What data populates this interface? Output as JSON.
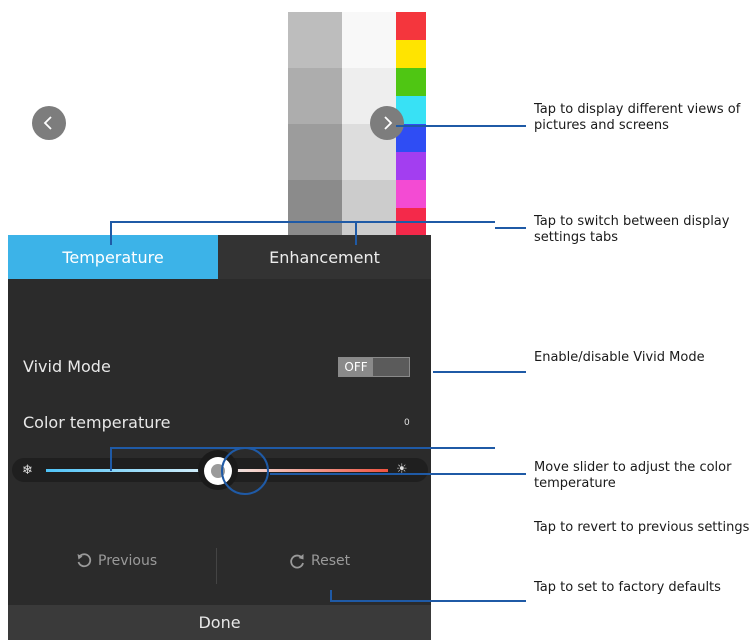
{
  "preview": {
    "nav_prev_icon": "chevron-left-icon",
    "nav_next_icon": "chevron-right-icon",
    "gray_column_1": [
      "#bdbdbd",
      "#adadad",
      "#9c9c9c",
      "#8b8b8b"
    ],
    "gray_column_2": [
      "#f8f8f8",
      "#eeeeee",
      "#dddddd",
      "#cccccc"
    ],
    "color_strip": [
      "#f4363d",
      "#ffe400",
      "#4fc613",
      "#38e1f5",
      "#2f4df4",
      "#a33ef0",
      "#f34bd3",
      "#f4294a"
    ]
  },
  "tabs": [
    {
      "label": "Temperature",
      "active": true
    },
    {
      "label": "Enhancement",
      "active": false
    }
  ],
  "settings": {
    "vivid_label": "Vivid Mode",
    "vivid_state": "OFF",
    "color_temp_label": "Color temperature",
    "color_temp_value": "0",
    "slider_position": 0.5,
    "cold_icon": "snowflake-icon",
    "warm_icon": "sun-icon"
  },
  "actions": {
    "previous_label": "Previous",
    "reset_label": "Reset",
    "done_label": "Done"
  },
  "callouts": {
    "views": "Tap to display different views of pictures and screens",
    "tabs": "Tap to switch between display settings tabs",
    "vivid": "Enable/disable Vivid Mode",
    "slider": "Move slider to adjust the color temperature",
    "previous": "Tap to revert to previous settings",
    "reset": "Tap to set to factory defaults"
  },
  "colors": {
    "accent": "#3cb3e8",
    "callout_line": "#1f5aa6",
    "panel_bg": "#2b2b2b"
  }
}
